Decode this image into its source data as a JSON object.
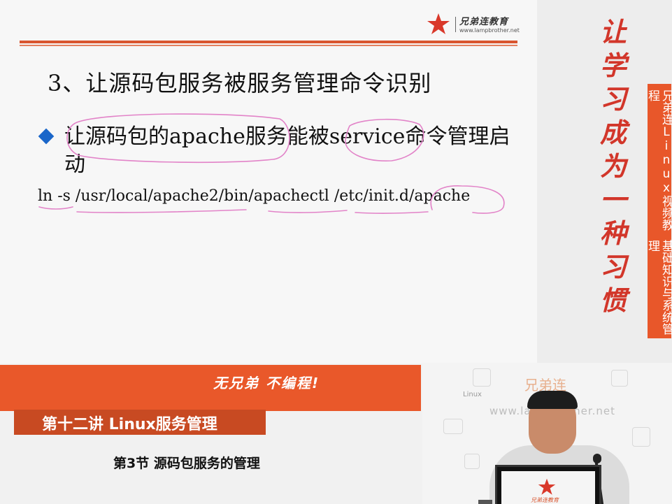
{
  "logo": {
    "name": "兄弟连教育",
    "url": "www.lampbrother.net"
  },
  "slide": {
    "heading": "3、让源码包服务被服务管理命令识别",
    "bullet": "让源码包的apache服务能被service命令管理启动",
    "command": "ln -s /usr/local/apache2/bin/apachectl /etc/init.d/apache"
  },
  "sidebar": {
    "slogan": "让学习成为一种习惯",
    "tab_part1": "兄弟连Linux视频教程",
    "tab_part2": "基础知识与系统管理"
  },
  "footer": {
    "motto": "无兄弟 不编程!",
    "lecture": "第十二讲 Linux服务管理",
    "section": "第3节 源码包服务的管理"
  },
  "video": {
    "brand": "兄弟连",
    "linux": "Linux",
    "url": "www.lampbrother.net",
    "monitor_tag": "兄弟连教育"
  },
  "colors": {
    "accent": "#e9582a",
    "accent_dark": "#c84a22",
    "slogan_red": "#d2362a",
    "bullet_blue": "#1a66c9",
    "annotation_pink": "#e283c8"
  },
  "icons": [
    "star-logo-icon",
    "diamond-bullet-icon"
  ]
}
